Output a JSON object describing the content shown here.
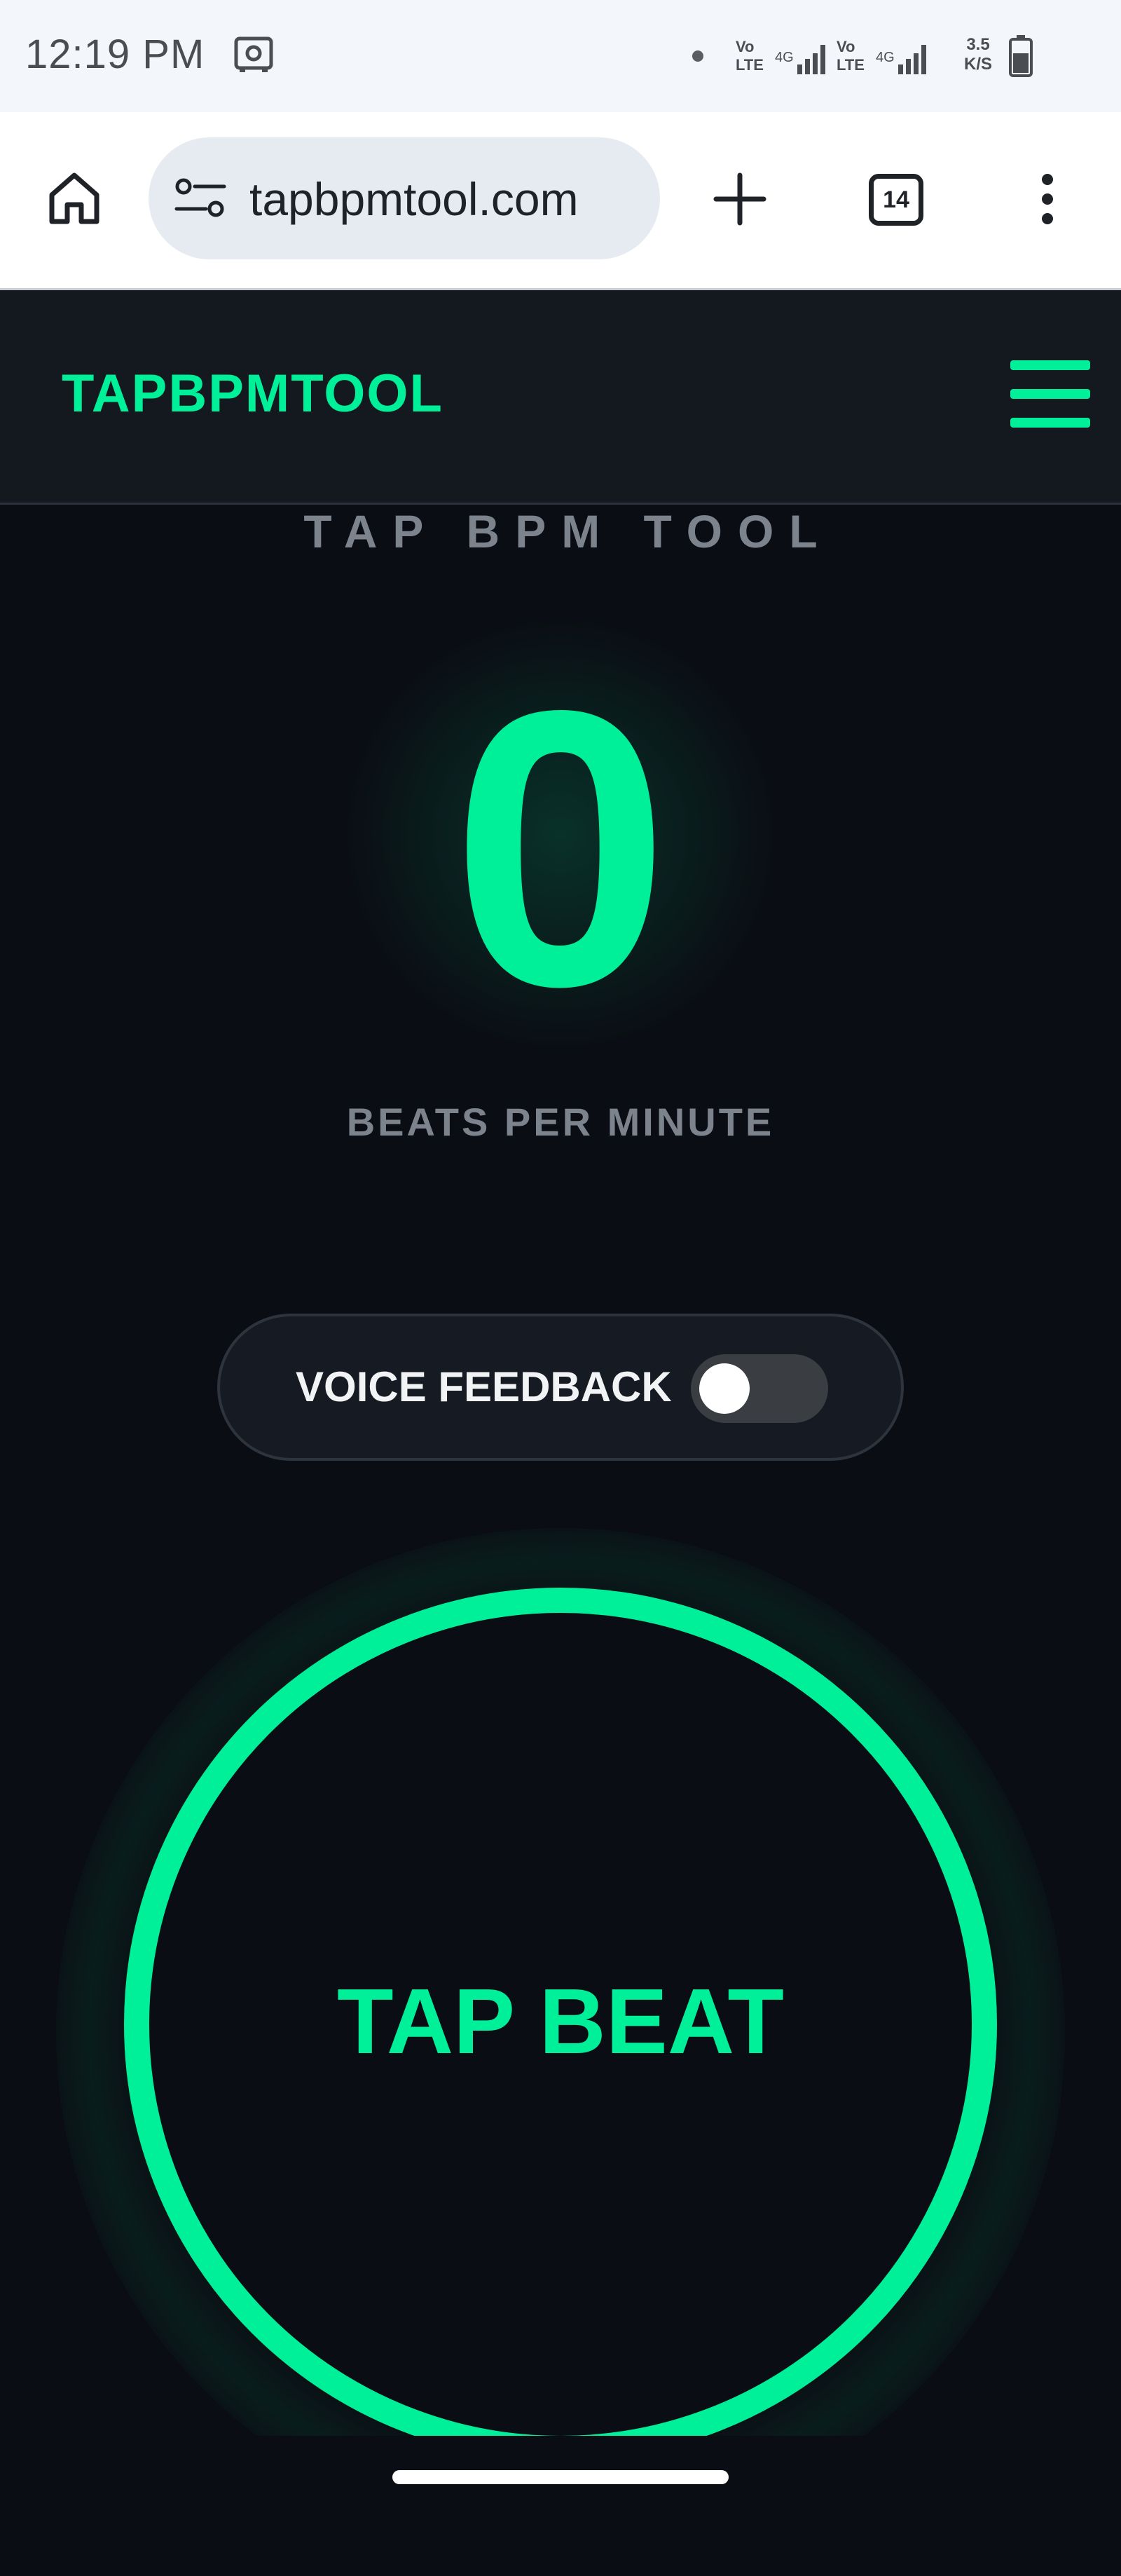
{
  "status_bar": {
    "time": "12:19 PM",
    "network_speed": "3.5",
    "network_speed_unit": "K/S",
    "sim1_type": "Vo LTE",
    "sim1_gen": "4G",
    "sim2_type": "Vo LTE",
    "sim2_gen": "4G"
  },
  "browser": {
    "url": "tapbpmtool.com",
    "tab_count": "14"
  },
  "site": {
    "logo": "TAPBPMTOOL"
  },
  "tool": {
    "title": "TAP BPM TOOL",
    "bpm_value": "0",
    "bpm_label": "BEATS PER MINUTE",
    "voice_feedback_label": "VOICE FEEDBACK",
    "voice_feedback_on": false,
    "tap_button_label": "TAP BEAT"
  },
  "colors": {
    "accent": "#00f09a",
    "background": "#0a0d13",
    "header_bg": "#141920"
  }
}
